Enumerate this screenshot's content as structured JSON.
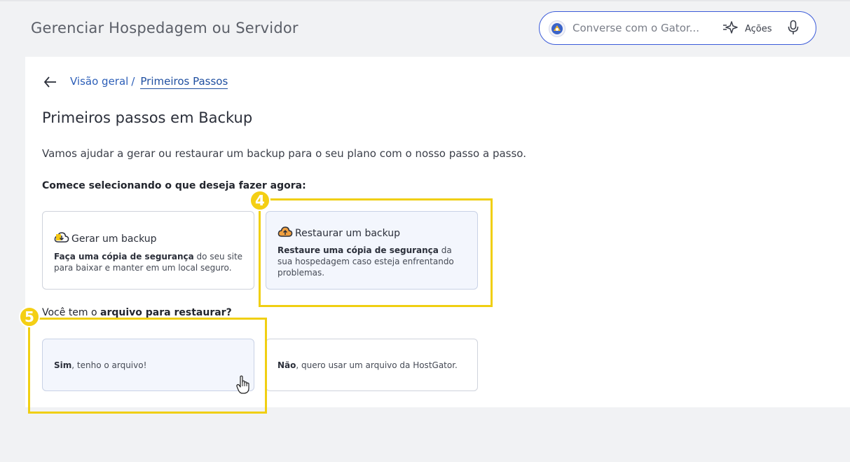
{
  "header": {
    "title": "Gerenciar Hospedagem ou Servidor",
    "chat_placeholder": "Converse com o Gator...",
    "actions_label": "Ações"
  },
  "breadcrumb": {
    "parent": "Visão geral",
    "separator": "/",
    "current": "Primeiros Passos"
  },
  "main": {
    "title": "Primeiros passos em Backup",
    "description": "Vamos ajudar a gerar ou restaurar um backup para o seu plano com o nosso passo a passo.",
    "prompt_action": "Comece selecionando o que deseja fazer agora:",
    "prompt_file_pre": "Você tem o ",
    "prompt_file_bold": "arquivo para restaurar?",
    "options": [
      {
        "title": "Gerar um backup",
        "body_bold": "Faça uma cópia de segurança",
        "body_rest": " do seu site para baixar e manter em um local seguro."
      },
      {
        "title": "Restaurar um backup",
        "body_bold": "Restaure uma cópia de segurança",
        "body_rest": " da sua hospedagem caso esteja enfrentando problemas."
      }
    ],
    "file_options": [
      {
        "bold": "Sim",
        "rest": ", tenho o arquivo!"
      },
      {
        "bold": "Não",
        "rest": ", quero usar um arquivo da HostGator."
      }
    ]
  },
  "annotations": {
    "step4": "4",
    "step5": "5",
    "highlight_color": "#f0cf12"
  },
  "colors": {
    "accent": "#2d5fb8",
    "selected_card_bg": "#f3f6fd",
    "chat_border": "#3b5bd9"
  }
}
